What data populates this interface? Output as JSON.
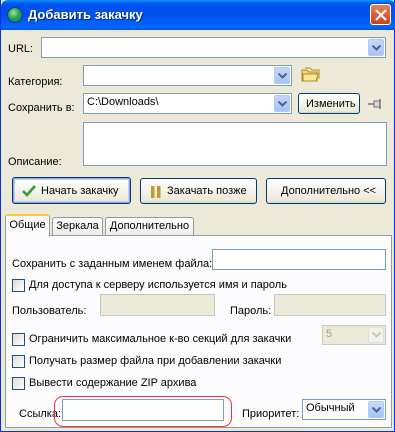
{
  "window": {
    "title": "Добавить закачку"
  },
  "url": {
    "label": "URL:",
    "value": ""
  },
  "category": {
    "label": "Категория:",
    "value": ""
  },
  "save_to": {
    "label": "Сохранить в:",
    "value": "C:\\Downloads\\",
    "change_button": "Изменить"
  },
  "description": {
    "label": "Описание:",
    "value": ""
  },
  "actions": {
    "start": "Начать закачку",
    "later": "Закачать позже",
    "advanced": "Дополнительно <<"
  },
  "tabs": [
    {
      "label": "Общие",
      "active": true
    },
    {
      "label": "Зеркала",
      "active": false
    },
    {
      "label": "Дополнительно",
      "active": false
    }
  ],
  "general": {
    "save_as_label": "Сохранить с заданным именем файла:",
    "save_as_value": "",
    "auth_checkbox": "Для доступа к серверу используется имя и пароль",
    "user_label": "Пользователь:",
    "password_label": "Пароль:",
    "limit_sections_checkbox": "Ограничить максимальное к-во секций для закачки",
    "sections_value": "5",
    "get_size_checkbox": "Получать размер файла при добавлении закачки",
    "zip_checkbox": "Вывести содержание ZIP архива",
    "referrer_label": "Ссылка:",
    "referrer_value": "",
    "priority_label": "Приоритет:",
    "priority_value": "Обычный"
  }
}
